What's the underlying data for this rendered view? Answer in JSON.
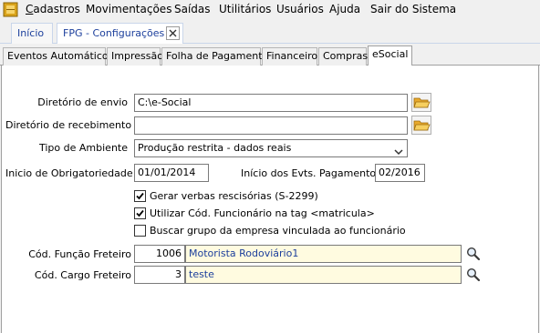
{
  "menubar": {
    "items": [
      {
        "label": "Cadastros",
        "mnemonic": "C"
      },
      {
        "label": "Movimentações",
        "mnemonic": "M"
      },
      {
        "label": "Saídas",
        "mnemonic": "S"
      },
      {
        "label": "Utilitários",
        "mnemonic": "U"
      },
      {
        "label": "Usuários",
        "mnemonic": "U"
      },
      {
        "label": "Ajuda",
        "mnemonic": "A"
      },
      {
        "label": "Sair do Sistema",
        "mnemonic": ""
      }
    ]
  },
  "top_tabs": [
    {
      "label": "Início",
      "active": false
    },
    {
      "label": "FPG - Configurações",
      "active": true,
      "close_icon": "close-icon"
    }
  ],
  "inner_tabs": [
    {
      "label": "Eventos Automáticos",
      "active": false
    },
    {
      "label": "Impressão",
      "active": false
    },
    {
      "label": "Folha de Pagamento",
      "active": false
    },
    {
      "label": "Financeiro",
      "active": false
    },
    {
      "label": "Compras",
      "active": false
    },
    {
      "label": "eSocial",
      "active": true
    }
  ],
  "form": {
    "diretorio_envio": {
      "label": "Diretório de envio",
      "value": "C:\\e-Social"
    },
    "diretorio_recebimento": {
      "label": "Diretório de recebimento",
      "value": ""
    },
    "tipo_ambiente": {
      "label": "Tipo de Ambiente",
      "value": "Produção restrita - dados reais"
    },
    "inicio_obrigatoriedade": {
      "label": "Inicio de Obrigatoriedade",
      "value": "01/01/2014"
    },
    "inicio_evts_pagamento": {
      "label": "Início dos Evts. Pagamento",
      "value": "02/2016"
    },
    "checkboxes": [
      {
        "label": "Gerar verbas rescisórias (S-2299)",
        "checked": true
      },
      {
        "label": "Utilizar Cód. Funcionário na tag <matricula>",
        "checked": true
      },
      {
        "label": "Buscar grupo da empresa vinculada ao funcionário",
        "checked": false
      }
    ],
    "cod_funcao_freteiro": {
      "label": "Cód. Função Freteiro",
      "code": "1006",
      "description": "Motorista Rodoviário1"
    },
    "cod_cargo_freteiro": {
      "label": "Cód. Cargo Freteiro",
      "code": "3",
      "description": "teste"
    }
  },
  "colors": {
    "tab_text": "#1c3f9c",
    "lookup_background": "#fffbe0",
    "folder_icon": "#f2c14e"
  },
  "icons": {
    "app": "app-logo-icon",
    "folder": "folder-open-icon",
    "search": "magnifier-icon",
    "dropdown": "chevron-down-icon"
  }
}
